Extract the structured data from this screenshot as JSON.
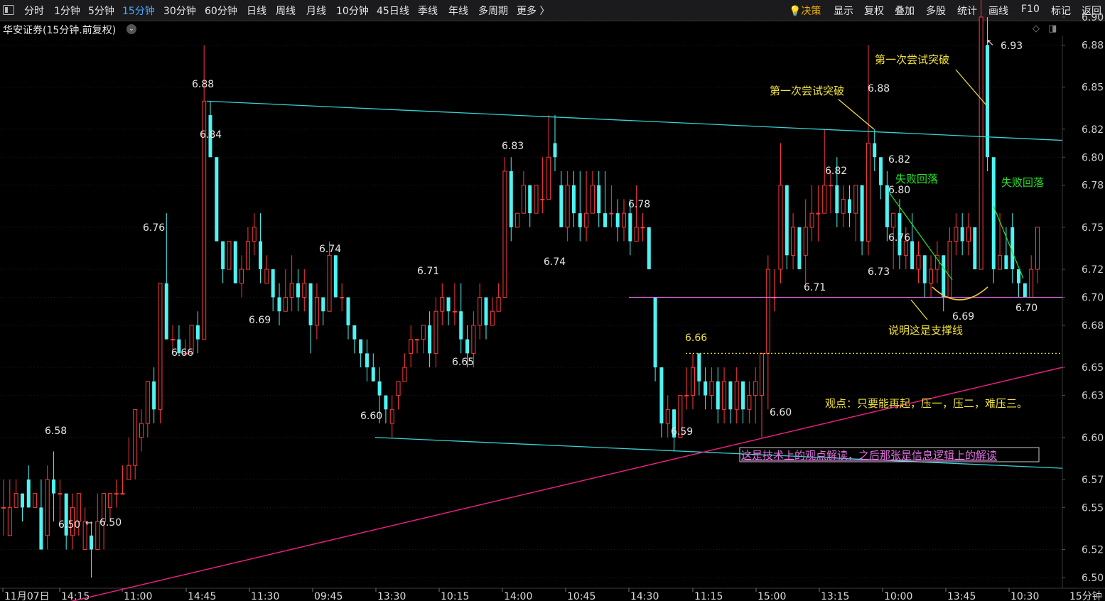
{
  "toolbar": {
    "left_items": [
      "分时",
      "1分钟",
      "5分钟",
      "15分钟",
      "30分钟",
      "60分钟",
      "日线",
      "周线",
      "月线",
      "10分钟",
      "45日线",
      "季线",
      "年线",
      "多周期",
      "更多 〉"
    ],
    "active_item": "15分钟",
    "decision_label": "决策",
    "right_items": [
      "显示",
      "复权",
      "叠加",
      "多股",
      "统计",
      "画线",
      "F10",
      "标记",
      "返回"
    ]
  },
  "stock_title": "华安证券(15分钟.前复权)",
  "colors": {
    "up": "#ff3b3b",
    "down": "#4ff3f3",
    "trend_cyan": "#36d3d3",
    "trend_magenta": "#e8207f",
    "support": "#e070e0",
    "yellow_dotted": "#d8d83a",
    "note_yellow": "#f2e33a",
    "note_green": "#27e427"
  },
  "chart_data": {
    "type": "candlestick",
    "title": "华安证券(15分钟.前复权)",
    "y_ticks": [
      "6.90",
      "6.88",
      "6.85",
      "6.82",
      "6.80",
      "6.78",
      "6.75",
      "6.72",
      "6.70",
      "6.68",
      "6.65",
      "6.63",
      "6.60",
      "6.57",
      "6.55",
      "6.52",
      "6.50"
    ],
    "x_ticks": [
      "11月07日",
      "14:15",
      "11:00",
      "14:45",
      "11:30",
      "09:45",
      "13:30",
      "10:15",
      "14:00",
      "10:45",
      "14:30",
      "11:15",
      "15:00",
      "13:15",
      "10:00",
      "13:45",
      "10:30"
    ],
    "period_label": "15分钟",
    "candles": [
      [
        6.55,
        6.55,
        6.57,
        6.53
      ],
      [
        6.53,
        6.55,
        6.57,
        6.53
      ],
      [
        6.55,
        6.56,
        6.57,
        6.55
      ],
      [
        6.56,
        6.55,
        6.56,
        6.54
      ],
      [
        6.57,
        6.55,
        6.58,
        6.55
      ],
      [
        6.55,
        6.56,
        6.56,
        6.55
      ],
      [
        6.55,
        6.52,
        6.57,
        6.52
      ],
      [
        6.53,
        6.57,
        6.58,
        6.52
      ],
      [
        6.57,
        6.56,
        6.59,
        6.54
      ],
      [
        6.56,
        6.56,
        6.57,
        6.54
      ],
      [
        6.56,
        6.53,
        6.56,
        6.52
      ],
      [
        6.53,
        6.55,
        6.56,
        6.52
      ],
      [
        6.54,
        6.56,
        6.56,
        6.53
      ],
      [
        6.52,
        6.54,
        6.55,
        6.52
      ],
      [
        6.53,
        6.52,
        6.54,
        6.5
      ],
      [
        6.52,
        6.54,
        6.56,
        6.52
      ],
      [
        6.54,
        6.56,
        6.56,
        6.52
      ],
      [
        6.55,
        6.56,
        6.56,
        6.54
      ],
      [
        6.56,
        6.56,
        6.57,
        6.55
      ],
      [
        6.56,
        6.56,
        6.58,
        6.56
      ],
      [
        6.57,
        6.58,
        6.6,
        6.57
      ],
      [
        6.58,
        6.62,
        6.61,
        6.57
      ],
      [
        6.6,
        6.61,
        6.62,
        6.59
      ],
      [
        6.61,
        6.64,
        6.64,
        6.6
      ],
      [
        6.64,
        6.62,
        6.65,
        6.61
      ],
      [
        6.62,
        6.71,
        6.7,
        6.61
      ],
      [
        6.71,
        6.67,
        6.76,
        6.67
      ],
      [
        6.67,
        6.67,
        6.68,
        6.66
      ],
      [
        6.67,
        6.66,
        6.68,
        6.66
      ],
      [
        6.66,
        6.66,
        6.67,
        6.66
      ],
      [
        6.66,
        6.68,
        6.68,
        6.66
      ],
      [
        6.68,
        6.67,
        6.69,
        6.66
      ],
      [
        6.67,
        6.84,
        6.88,
        6.67
      ],
      [
        6.83,
        6.8,
        6.84,
        6.8
      ],
      [
        6.8,
        6.74,
        6.8,
        6.74
      ],
      [
        6.74,
        6.72,
        6.74,
        6.71
      ],
      [
        6.72,
        6.74,
        6.74,
        6.72
      ],
      [
        6.74,
        6.71,
        6.74,
        6.71
      ],
      [
        6.71,
        6.72,
        6.73,
        6.7
      ],
      [
        6.72,
        6.74,
        6.75,
        6.72
      ],
      [
        6.74,
        6.75,
        6.76,
        6.73
      ],
      [
        6.74,
        6.72,
        6.76,
        6.71
      ],
      [
        6.71,
        6.72,
        6.73,
        6.71
      ],
      [
        6.72,
        6.7,
        6.72,
        6.69
      ],
      [
        6.7,
        6.69,
        6.71,
        6.68
      ],
      [
        6.69,
        6.7,
        6.72,
        6.69
      ],
      [
        6.7,
        6.71,
        6.73,
        6.69
      ],
      [
        6.71,
        6.7,
        6.72,
        6.69
      ],
      [
        6.7,
        6.71,
        6.72,
        6.69
      ],
      [
        6.71,
        6.68,
        6.71,
        6.66
      ],
      [
        6.68,
        6.7,
        6.71,
        6.67
      ],
      [
        6.7,
        6.69,
        6.7,
        6.68
      ],
      [
        6.69,
        6.73,
        6.74,
        6.69
      ],
      [
        6.73,
        6.7,
        6.73,
        6.7
      ],
      [
        6.7,
        6.7,
        6.71,
        6.69
      ],
      [
        6.7,
        6.68,
        6.7,
        6.67
      ],
      [
        6.68,
        6.67,
        6.68,
        6.66
      ],
      [
        6.67,
        6.66,
        6.67,
        6.65
      ],
      [
        6.66,
        6.65,
        6.67,
        6.64
      ],
      [
        6.65,
        6.64,
        6.66,
        6.64
      ],
      [
        6.64,
        6.63,
        6.65,
        6.61
      ],
      [
        6.63,
        6.62,
        6.63,
        6.61
      ],
      [
        6.61,
        6.62,
        6.63,
        6.6
      ],
      [
        6.63,
        6.64,
        6.64,
        6.62
      ],
      [
        6.64,
        6.65,
        6.66,
        6.64
      ],
      [
        6.66,
        6.67,
        6.68,
        6.65
      ],
      [
        6.67,
        6.67,
        6.67,
        6.66
      ],
      [
        6.67,
        6.68,
        6.68,
        6.66
      ],
      [
        6.68,
        6.66,
        6.69,
        6.65
      ],
      [
        6.66,
        6.69,
        6.7,
        6.65
      ],
      [
        6.69,
        6.7,
        6.71,
        6.68
      ],
      [
        6.7,
        6.69,
        6.7,
        6.68
      ],
      [
        6.69,
        6.69,
        6.71,
        6.68
      ],
      [
        6.69,
        6.67,
        6.71,
        6.66
      ],
      [
        6.67,
        6.66,
        6.68,
        6.65
      ],
      [
        6.66,
        6.68,
        6.69,
        6.65
      ],
      [
        6.68,
        6.7,
        6.71,
        6.67
      ],
      [
        6.7,
        6.68,
        6.7,
        6.67
      ],
      [
        6.68,
        6.69,
        6.7,
        6.68
      ],
      [
        6.69,
        6.7,
        6.71,
        6.69
      ],
      [
        6.7,
        6.79,
        6.8,
        6.7
      ],
      [
        6.79,
        6.75,
        6.8,
        6.74
      ],
      [
        6.75,
        6.76,
        6.76,
        6.75
      ],
      [
        6.76,
        6.78,
        6.79,
        6.76
      ],
      [
        6.78,
        6.76,
        6.78,
        6.75
      ],
      [
        6.76,
        6.78,
        6.78,
        6.76
      ],
      [
        6.77,
        6.77,
        6.8,
        6.76
      ],
      [
        6.77,
        6.8,
        6.83,
        6.77
      ],
      [
        6.81,
        6.8,
        6.83,
        6.79
      ],
      [
        6.78,
        6.75,
        6.79,
        6.75
      ],
      [
        6.75,
        6.78,
        6.79,
        6.74
      ],
      [
        6.78,
        6.76,
        6.79,
        6.75
      ],
      [
        6.76,
        6.75,
        6.79,
        6.74
      ],
      [
        6.75,
        6.76,
        6.79,
        6.74
      ],
      [
        6.76,
        6.78,
        6.79,
        6.76
      ],
      [
        6.78,
        6.76,
        6.79,
        6.75
      ],
      [
        6.76,
        6.75,
        6.79,
        6.75
      ],
      [
        6.76,
        6.76,
        6.78,
        6.75
      ],
      [
        6.76,
        6.75,
        6.77,
        6.74
      ],
      [
        6.75,
        6.76,
        6.77,
        6.74
      ],
      [
        6.76,
        6.74,
        6.77,
        6.73
      ],
      [
        6.74,
        6.75,
        6.78,
        6.74
      ],
      [
        6.75,
        6.75,
        6.76,
        6.74
      ],
      [
        6.75,
        6.72,
        6.75,
        6.72
      ],
      [
        6.7,
        6.65,
        6.7,
        6.64
      ],
      [
        6.65,
        6.61,
        6.65,
        6.6
      ],
      [
        6.61,
        6.62,
        6.63,
        6.6
      ],
      [
        6.62,
        6.6,
        6.62,
        6.59
      ],
      [
        6.6,
        6.63,
        6.63,
        6.6
      ],
      [
        6.63,
        6.63,
        6.65,
        6.62
      ],
      [
        6.63,
        6.65,
        6.66,
        6.62
      ],
      [
        6.66,
        6.64,
        6.66,
        6.63
      ],
      [
        6.64,
        6.63,
        6.65,
        6.62
      ],
      [
        6.63,
        6.64,
        6.65,
        6.62
      ],
      [
        6.64,
        6.62,
        6.65,
        6.61
      ],
      [
        6.62,
        6.64,
        6.65,
        6.61
      ],
      [
        6.64,
        6.62,
        6.64,
        6.61
      ],
      [
        6.62,
        6.64,
        6.65,
        6.61
      ],
      [
        6.64,
        6.62,
        6.64,
        6.61
      ],
      [
        6.62,
        6.63,
        6.64,
        6.61
      ],
      [
        6.63,
        6.64,
        6.65,
        6.61
      ],
      [
        6.63,
        6.66,
        6.66,
        6.6
      ],
      [
        6.66,
        6.72,
        6.73,
        6.62
      ],
      [
        6.7,
        6.7,
        6.72,
        6.69
      ],
      [
        6.72,
        6.78,
        6.81,
        6.71
      ],
      [
        6.78,
        6.73,
        6.78,
        6.72
      ],
      [
        6.73,
        6.75,
        6.76,
        6.72
      ],
      [
        6.75,
        6.72,
        6.75,
        6.72
      ],
      [
        6.73,
        6.75,
        6.77,
        6.71
      ],
      [
        6.75,
        6.76,
        6.78,
        6.74
      ],
      [
        6.76,
        6.76,
        6.78,
        6.74
      ],
      [
        6.76,
        6.78,
        6.82,
        6.76
      ],
      [
        6.78,
        6.78,
        6.79,
        6.76
      ],
      [
        6.78,
        6.76,
        6.8,
        6.75
      ],
      [
        6.76,
        6.77,
        6.78,
        6.75
      ],
      [
        6.77,
        6.76,
        6.78,
        6.75
      ],
      [
        6.76,
        6.78,
        6.78,
        6.74
      ],
      [
        6.78,
        6.74,
        6.78,
        6.73
      ],
      [
        6.74,
        6.81,
        6.88,
        6.73
      ],
      [
        6.81,
        6.8,
        6.82,
        6.79
      ],
      [
        6.8,
        6.78,
        6.8,
        6.77
      ],
      [
        6.78,
        6.75,
        6.79,
        6.74
      ],
      [
        6.75,
        6.76,
        6.76,
        6.72
      ],
      [
        6.76,
        6.73,
        6.77,
        6.72
      ],
      [
        6.73,
        6.74,
        6.75,
        6.72
      ],
      [
        6.74,
        6.72,
        6.76,
        6.72
      ],
      [
        6.72,
        6.73,
        6.74,
        6.71
      ],
      [
        6.73,
        6.71,
        6.73,
        6.7
      ],
      [
        6.71,
        6.72,
        6.73,
        6.7
      ],
      [
        6.72,
        6.73,
        6.74,
        6.71
      ],
      [
        6.73,
        6.7,
        6.73,
        6.69
      ],
      [
        6.7,
        6.74,
        6.75,
        6.7
      ],
      [
        6.74,
        6.75,
        6.76,
        6.73
      ],
      [
        6.75,
        6.74,
        6.76,
        6.73
      ],
      [
        6.74,
        6.75,
        6.76,
        6.73
      ],
      [
        6.75,
        6.72,
        6.75,
        6.72
      ],
      [
        6.72,
        6.9,
        6.93,
        6.72
      ],
      [
        6.88,
        6.8,
        6.9,
        6.79
      ],
      [
        6.8,
        6.72,
        6.8,
        6.71
      ],
      [
        6.72,
        6.73,
        6.76,
        6.72
      ],
      [
        6.73,
        6.72,
        6.75,
        6.72
      ],
      [
        6.75,
        6.72,
        6.76,
        6.71
      ],
      [
        6.72,
        6.71,
        6.72,
        6.7
      ],
      [
        6.71,
        6.7,
        6.71,
        6.7
      ],
      [
        6.7,
        6.72,
        6.73,
        6.7
      ],
      [
        6.72,
        6.75,
        6.75,
        6.71
      ]
    ],
    "price_labels": [
      "6.58",
      "6.50",
      "6.50",
      "6.76",
      "6.66",
      "6.88",
      "6.84",
      "6.69",
      "6.74",
      "6.60",
      "6.71",
      "6.65",
      "6.83",
      "6.74",
      "6.78",
      "6.59",
      "6.66",
      "6.60",
      "6.71",
      "6.82",
      "6.73",
      "6.88",
      "6.82",
      "6.80",
      "6.76",
      "6.69",
      "6.93",
      "6.70"
    ],
    "annotations": {
      "first_attempt": "第一次尝试突破",
      "failed_pullback": "失败回落",
      "support_note": "说明这是支撑线",
      "viewpoint": "观点：只要能再起，压一，压二，难压三。",
      "disclaimer": "这是技术上的观点解读，之后那张是信息逻辑上的解读"
    }
  }
}
